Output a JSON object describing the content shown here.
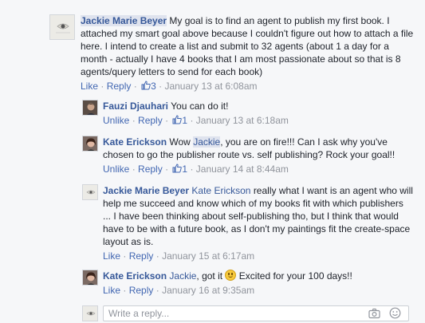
{
  "comments": [
    {
      "author": "Jackie Marie Beyer",
      "text": "My goal is to find an agent to publish my first book. I attached my smart goal above because I couldn't figure out how to attach a file here. I intend to create a list and submit to 32 agents (about 1 a day for a month - actually I have 4 books that I am most passionate about so that is 8 agents/query letters to send for each book)",
      "actions": {
        "like": "Like",
        "reply": "Reply",
        "like_count": "3",
        "time": "January 13 at 6:08am"
      }
    }
  ],
  "replies": [
    {
      "author": "Fauzi Djauhari",
      "text": "You can do it!",
      "actions": {
        "like": "Unlike",
        "reply": "Reply",
        "like_count": "1",
        "time": "January 13 at 6:18am"
      }
    },
    {
      "author": "Kate Erickson",
      "text_before": "Wow",
      "mention": "Jackie",
      "text_after": ", you are on fire!!! Can I ask why you've chosen to go the publisher route vs. self publishing? Rock your goal!!",
      "actions": {
        "like": "Unlike",
        "reply": "Reply",
        "like_count": "1",
        "time": "January 14 at 8:44am"
      }
    },
    {
      "author": "Jackie Marie Beyer",
      "mention": "Kate Erickson",
      "text_after": "really what I want is an agent who will help me succeed and know which of my books fit with which publishers ... I have been thinking about self-publishing tho, but I think that would have to be with a future book, as I don't my paintings fit the create-space layout as is.",
      "actions": {
        "like": "Like",
        "reply": "Reply",
        "time": "January 15 at 6:17am"
      }
    },
    {
      "author": "Kate Erickson",
      "mention": "Jackie",
      "text_before": ", got it",
      "text_after": "Excited for your 100 days!!",
      "actions": {
        "like": "Like",
        "reply": "Reply",
        "time": "January 16 at 9:35am"
      }
    }
  ],
  "reply_box": {
    "placeholder": "Write a reply..."
  },
  "sep": "·",
  "icons": [
    "like-thumb-icon",
    "camera-icon",
    "smiley-icon"
  ],
  "colors": {
    "link": "#4267b2",
    "author": "#365899",
    "meta": "#90949c",
    "background": "#f6f7f9"
  }
}
